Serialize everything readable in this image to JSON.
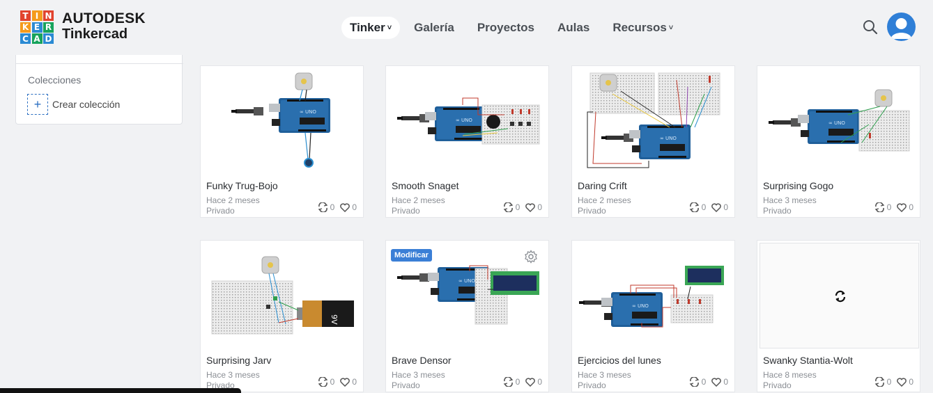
{
  "brand": {
    "logo_letters": [
      "T",
      "I",
      "N",
      "K",
      "E",
      "R",
      "C",
      "A",
      "D"
    ],
    "logo_colors": [
      "#e1432d",
      "#f59b1c",
      "#e1432d",
      "#f59b1c",
      "#2a8ad3",
      "#17a35c",
      "#2a8ad3",
      "#17a35c",
      "#2a8ad3"
    ],
    "name_top": "AUTODESK",
    "name_bottom": "Tinkercad"
  },
  "nav": {
    "items": [
      {
        "label": "Tinker",
        "has_dropdown": true,
        "active": true
      },
      {
        "label": "Galería",
        "has_dropdown": false,
        "active": false
      },
      {
        "label": "Proyectos",
        "has_dropdown": false,
        "active": false
      },
      {
        "label": "Aulas",
        "has_dropdown": false,
        "active": false
      },
      {
        "label": "Recursos",
        "has_dropdown": true,
        "active": false
      }
    ],
    "chevron": "˅"
  },
  "icons": {
    "search": "search-icon",
    "avatar": "user-avatar-icon",
    "remix": "remix-icon",
    "heart": "heart-icon",
    "gear": "gear-icon",
    "refresh": "refresh-icon"
  },
  "sidebar": {
    "collections_label": "Colecciones",
    "create_plus": "+",
    "create_label": "Crear colección"
  },
  "accent_color": "#3b7fd6",
  "designs": [
    {
      "title": "Funky Trug-Bojo",
      "time": "Hace 2 meses",
      "privacy": "Privado",
      "remixes": "0",
      "likes": "0"
    },
    {
      "title": "Smooth Snaget",
      "time": "Hace 2 meses",
      "privacy": "Privado",
      "remixes": "0",
      "likes": "0"
    },
    {
      "title": "Daring Crift",
      "time": "Hace 2 meses",
      "privacy": "Privado",
      "remixes": "0",
      "likes": "0"
    },
    {
      "title": "Surprising Gogo",
      "time": "Hace 3 meses",
      "privacy": "Privado",
      "remixes": "0",
      "likes": "0"
    },
    {
      "title": "Surprising Jarv",
      "time": "Hace 3 meses",
      "privacy": "Privado",
      "remixes": "0",
      "likes": "0"
    },
    {
      "title": "Brave Densor",
      "time": "Hace 3 meses",
      "privacy": "Privado",
      "remixes": "0",
      "likes": "0",
      "modify_label": "Modificar"
    },
    {
      "title": "Ejercicios del lunes",
      "time": "Hace 3 meses",
      "privacy": "Privado",
      "remixes": "0",
      "likes": "0"
    },
    {
      "title": "Swanky Stantia-Wolt",
      "time": "Hace 8 meses",
      "privacy": "Privado",
      "remixes": "0",
      "likes": "0"
    }
  ]
}
